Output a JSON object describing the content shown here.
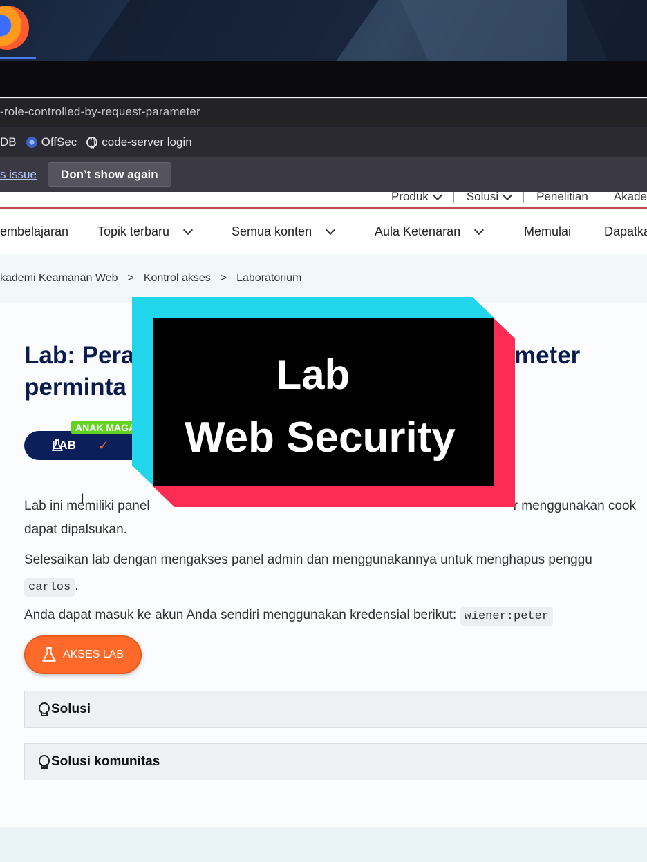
{
  "browser": {
    "url_fragment": "-role-controlled-by-request-parameter",
    "bookmarks": [
      {
        "label": "DB",
        "icon": "none"
      },
      {
        "label": "OffSec",
        "icon": "offsec-icon"
      },
      {
        "label": "code-server login",
        "icon": "globe-icon"
      }
    ],
    "notification": {
      "link_label": "s issue",
      "button_label": "Don’t show again"
    }
  },
  "topnav": {
    "items": [
      "Produk",
      "Solusi",
      "Penelitian",
      "Akade"
    ]
  },
  "mainnav": {
    "items": [
      "embelajaran",
      "Topik terbaru",
      "Semua konten",
      "Aula Ketenaran",
      "Memulai",
      "Dapatka"
    ]
  },
  "breadcrumb": {
    "items": [
      "kademi Keamanan Web",
      "Kontrol akses",
      "Laboratorium"
    ],
    "separator": ">"
  },
  "lab": {
    "title_line1": "Lab: Pera",
    "title_line1_right": "ameter",
    "title_line2": "perminta",
    "level_tag": "ANAK MAGANG",
    "badge_label": "LAB",
    "check_glyph": "✓",
    "desc1_left": "Lab ini memiliki panel",
    "desc1_right": "r menggunakan cook",
    "desc1_line2": "dapat dipalsukan.",
    "desc2": "Selesaikan lab dengan mengakses panel admin dan menggunakannya untuk menghapus penggu",
    "desc2_code": "carlos",
    "desc2_end": ".",
    "desc3": "Anda dapat masuk ke akun Anda sendiri menggunakan kredensial berikut:",
    "desc3_code": "wiener:peter",
    "access_button": "AKSES LAB",
    "solution_label": "Solusi",
    "community_label": "Solusi komunitas"
  },
  "overlay": {
    "line1": "Lab",
    "line2": "Web Security",
    "colors": {
      "cyan": "#21d6ea",
      "red": "#fd2c55",
      "black": "#000000"
    }
  },
  "colors": {
    "navy": "#0c1f5a",
    "orange": "#ff6a2b",
    "level_green": "#62d321"
  }
}
